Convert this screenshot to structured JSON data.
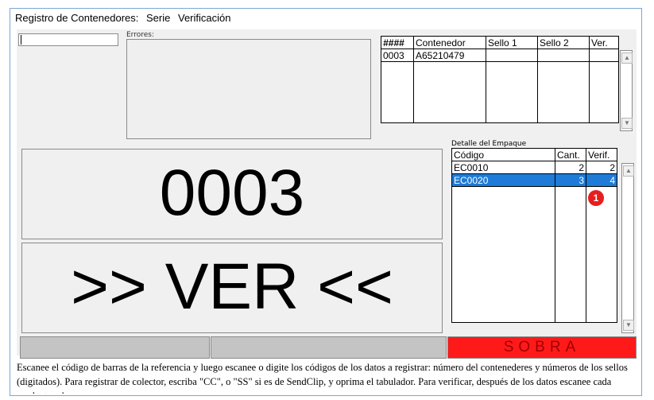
{
  "title_bar": {
    "app": "Registro de Contenedores:",
    "menu": [
      "Serie",
      "Verificación"
    ]
  },
  "errors_label": "Errores:",
  "containers": {
    "headers": [
      "####",
      "Contenedor",
      "Sello 1",
      "Sello 2",
      "Ver."
    ],
    "rows": [
      [
        "0003",
        "A65210479",
        "",
        "",
        ""
      ]
    ]
  },
  "detail": {
    "label": "Detalle del Empaque",
    "headers": [
      "Código",
      "Cant.",
      "Verif."
    ],
    "rows": [
      [
        "EC0010",
        "2",
        "2"
      ],
      [
        "EC0020",
        "3",
        "4"
      ]
    ],
    "selected_row": 1
  },
  "big_number": "0003",
  "big_status": ">> VER <<",
  "status_bar": {
    "right": "SOBRA",
    "right_color": "#ff1a1a"
  },
  "badge": "1",
  "help_text": "Escanee el código de barras de la referencia y luego escanee o digite los códigos de los datos a registrar: número del contenederes y números de los sellos (digitados). Para registrar de colector, escriba \"CC\", o \"SS\" si es de SendClip, y oprima el tabulador. Para verificar, después de los datos escanee cada producto; al"
}
